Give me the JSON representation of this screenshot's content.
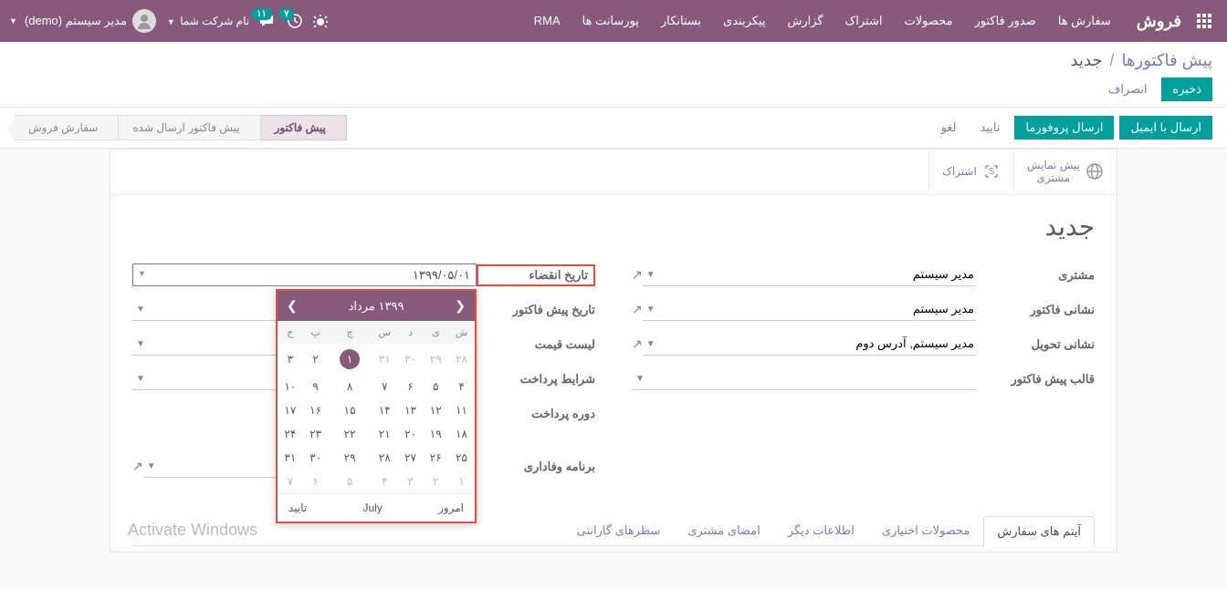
{
  "topnav": {
    "brand": "فروش",
    "menu": [
      "سفارش ها",
      "صدور فاکتور",
      "محصولات",
      "اشتراک",
      "گزارش",
      "پیکربندی",
      "بستانکار",
      "پورسانت ها",
      "RMA"
    ],
    "badge_activities": "۷",
    "badge_messages": "۱۱",
    "company": "نام شرکت شما",
    "user": "مدیر سیستم (demo)"
  },
  "breadcrumb": {
    "parent": "پیش فاکتورها",
    "current": "جدید"
  },
  "head_actions": {
    "save": "ذخیره",
    "discard": "انصراف"
  },
  "actionbar": {
    "send_email": "ارسال با ایمیل",
    "send_proforma": "ارسال پروفورما",
    "confirm": "تایید",
    "cancel": "لغو",
    "steps": [
      "پیش فاکتور",
      "پیش فاکتور ارسال شده",
      "سفارش فروش"
    ]
  },
  "sheet_topbar": {
    "preview": "پیش نمایش\nمشتری",
    "subscription": "اشتراک"
  },
  "record": {
    "title": "جدید"
  },
  "form": {
    "right": {
      "customer_label": "مشتری",
      "customer_value": "مدیر سیستم",
      "invoice_addr_label": "نشانی فاکتور",
      "invoice_addr_value": "مدیر سیستم",
      "delivery_addr_label": "نشانی تحویل",
      "delivery_addr_value": "مدیر سیستم, آدرس دوم",
      "template_label": "قالب پیش فاکتور",
      "template_value": ""
    },
    "left": {
      "expiry_label": "تاریخ انقضاء",
      "expiry_value": "۱۳۹۹/۰۵/۰۱",
      "quote_date_label": "تاریخ پیش فاکتور",
      "pricelist_label": "لیست قیمت",
      "payment_terms_label": "شرایط پرداخت",
      "payment_period_label": "دوره پرداخت",
      "loyalty_label": "برنامه وفاداری"
    }
  },
  "calendar": {
    "title": "۱۳۹۹ مرداد",
    "weekdays": [
      "ش",
      "ی",
      "د",
      "س",
      "چ",
      "پ",
      "ج"
    ],
    "prev_days": [
      "۲۸",
      "۲۹",
      "۳۰",
      "۳۱"
    ],
    "days": [
      "۱",
      "۲",
      "۳",
      "۴",
      "۵",
      "۶",
      "۷",
      "۸",
      "۹",
      "۱۰",
      "۱۱",
      "۱۲",
      "۱۳",
      "۱۴",
      "۱۵",
      "۱۶",
      "۱۷",
      "۱۸",
      "۱۹",
      "۲۰",
      "۲۱",
      "۲۲",
      "۲۳",
      "۲۴",
      "۲۵",
      "۲۶",
      "۲۷",
      "۲۸",
      "۲۹",
      "۳۰",
      "۳۱"
    ],
    "next_days": [
      "۱",
      "۲",
      "۳",
      "۴",
      "۵",
      "۶",
      "۷"
    ],
    "selected_day": "۱",
    "today": "امروز",
    "alt_month": "July",
    "confirm": "تایید"
  },
  "tabs": [
    "آیتم های سفارش",
    "محصولات اختیاری",
    "اطلاعات دیگر",
    "امضای مشتری",
    "سطرهای گارانتی"
  ],
  "watermark": "Activate Windows"
}
